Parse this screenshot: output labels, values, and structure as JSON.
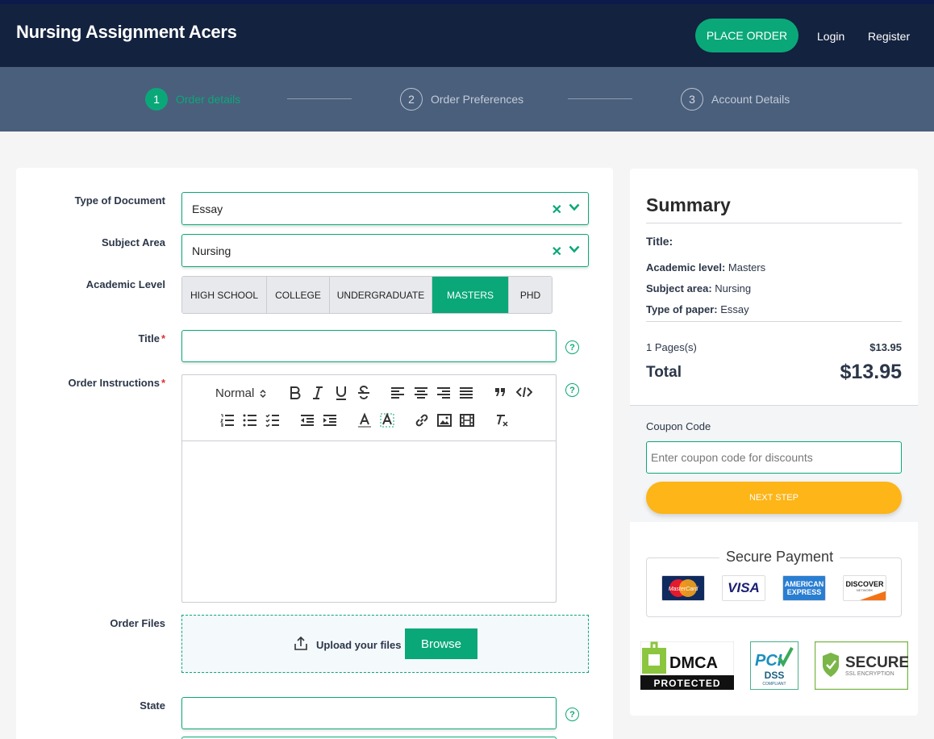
{
  "header": {
    "brand": "Nursing Assignment Acers",
    "place_order": "PLACE ORDER",
    "login": "Login",
    "register": "Register"
  },
  "steps": [
    {
      "num": "1",
      "label": "Order details",
      "active": true
    },
    {
      "num": "2",
      "label": "Order Preferences",
      "active": false
    },
    {
      "num": "3",
      "label": "Account Details",
      "active": false
    }
  ],
  "form": {
    "type_of_document": {
      "label": "Type of Document",
      "value": "Essay"
    },
    "subject_area": {
      "label": "Subject Area",
      "value": "Nursing"
    },
    "academic_level": {
      "label": "Academic Level",
      "options": [
        "HIGH SCHOOL",
        "COLLEGE",
        "UNDERGRADUATE",
        "MASTERS",
        "PHD"
      ],
      "selected": "MASTERS"
    },
    "title": {
      "label": "Title",
      "required_mark": "*",
      "value": ""
    },
    "order_instructions": {
      "label": "Order Instructions",
      "required_mark": "*",
      "format": "Normal",
      "value": ""
    },
    "order_files": {
      "label": "Order Files",
      "upload_label": "Upload your files",
      "browse": "Browse"
    },
    "state": {
      "label": "State",
      "value": ""
    },
    "help_glyph": "?"
  },
  "summary": {
    "heading": "Summary",
    "title_label": "Title:",
    "title_value": "",
    "academic_level_label": "Academic level:",
    "academic_level_value": "Masters",
    "subject_area_label": "Subject area:",
    "subject_area_value": "Nursing",
    "type_of_paper_label": "Type of paper:",
    "type_of_paper_value": "Essay",
    "pages": "1 Pages(s)",
    "pages_price": "$13.95",
    "total_label": "Total",
    "total_price": "$13.95",
    "coupon_label": "Coupon Code",
    "coupon_placeholder": "Enter coupon code for discounts",
    "next_step": "NEXT STEP",
    "secure_payment": "Secure Payment",
    "cards": {
      "mastercard": "MasterCard",
      "visa": "VISA",
      "amex_1": "AMERICAN",
      "amex_2": "EXPRESS",
      "discover": "DISCOVER",
      "discover_sub": "NETWORK"
    },
    "badges": {
      "dmca_top": "DMCA",
      "dmca_bottom": "PROTECTED",
      "pci_1": "PCI",
      "pci_2": "DSS",
      "pci_3": "COMPLIANT",
      "ssl_1": "SECURE",
      "ssl_2": "SSL ENCRYPTION"
    }
  },
  "colors": {
    "primary": "#0aa878",
    "navy": "#13223f",
    "steps_bg": "#4a5f7c",
    "accent": "#fdb517"
  }
}
